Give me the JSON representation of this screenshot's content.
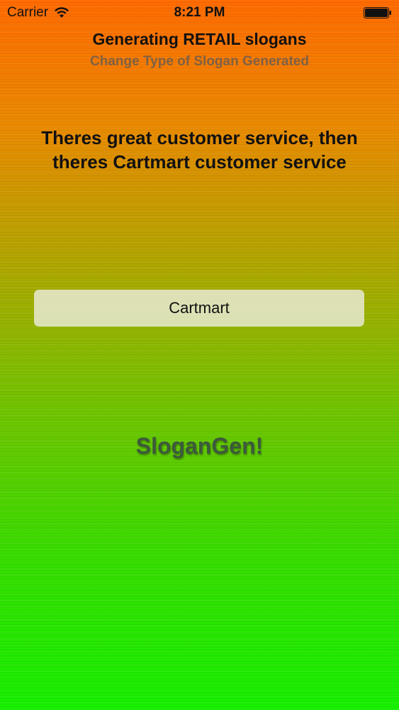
{
  "status_bar": {
    "carrier": "Carrier",
    "time": "8:21 PM",
    "wifi_icon": "wifi-icon",
    "battery_icon": "battery-icon"
  },
  "header": {
    "title": "Generating RETAIL slogans",
    "subtitle": "Change Type of Slogan Generated"
  },
  "main": {
    "slogan": "Theres great customer service, then theres Cartmart customer service",
    "company_name_value": "Cartmart",
    "generate_button_label": "SloganGen!"
  },
  "colors": {
    "gradient_top": "#ff6a00",
    "gradient_bottom": "#16f000"
  }
}
